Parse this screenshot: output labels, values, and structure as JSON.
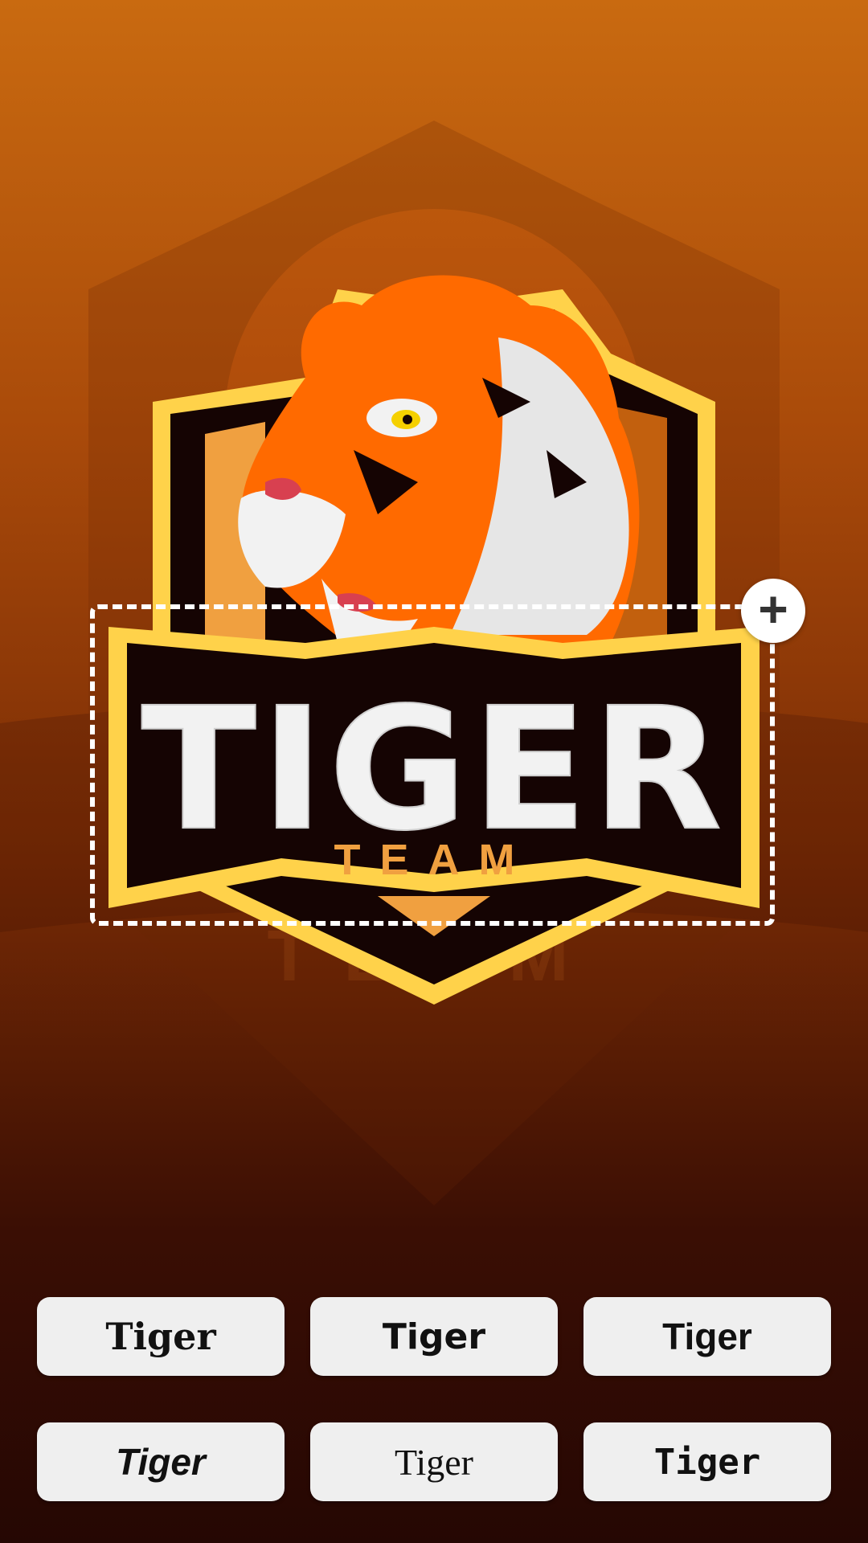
{
  "logo": {
    "title": "TIGER",
    "subtitle": "TEAM",
    "colors": {
      "shield_outline": "#ffd24a",
      "shield_fill": "#150403",
      "tiger_orange": "#ff6a00",
      "accent_orange": "#f0a040",
      "fur_white": "#f2f2f2"
    }
  },
  "selection": {
    "add_icon": "plus-icon",
    "add_symbol": "+"
  },
  "font_options": [
    {
      "label": "Tiger"
    },
    {
      "label": "Tiger"
    },
    {
      "label": "Tiger"
    },
    {
      "label": "Tiger"
    },
    {
      "label": "Tiger"
    },
    {
      "label": "Tiger"
    }
  ]
}
